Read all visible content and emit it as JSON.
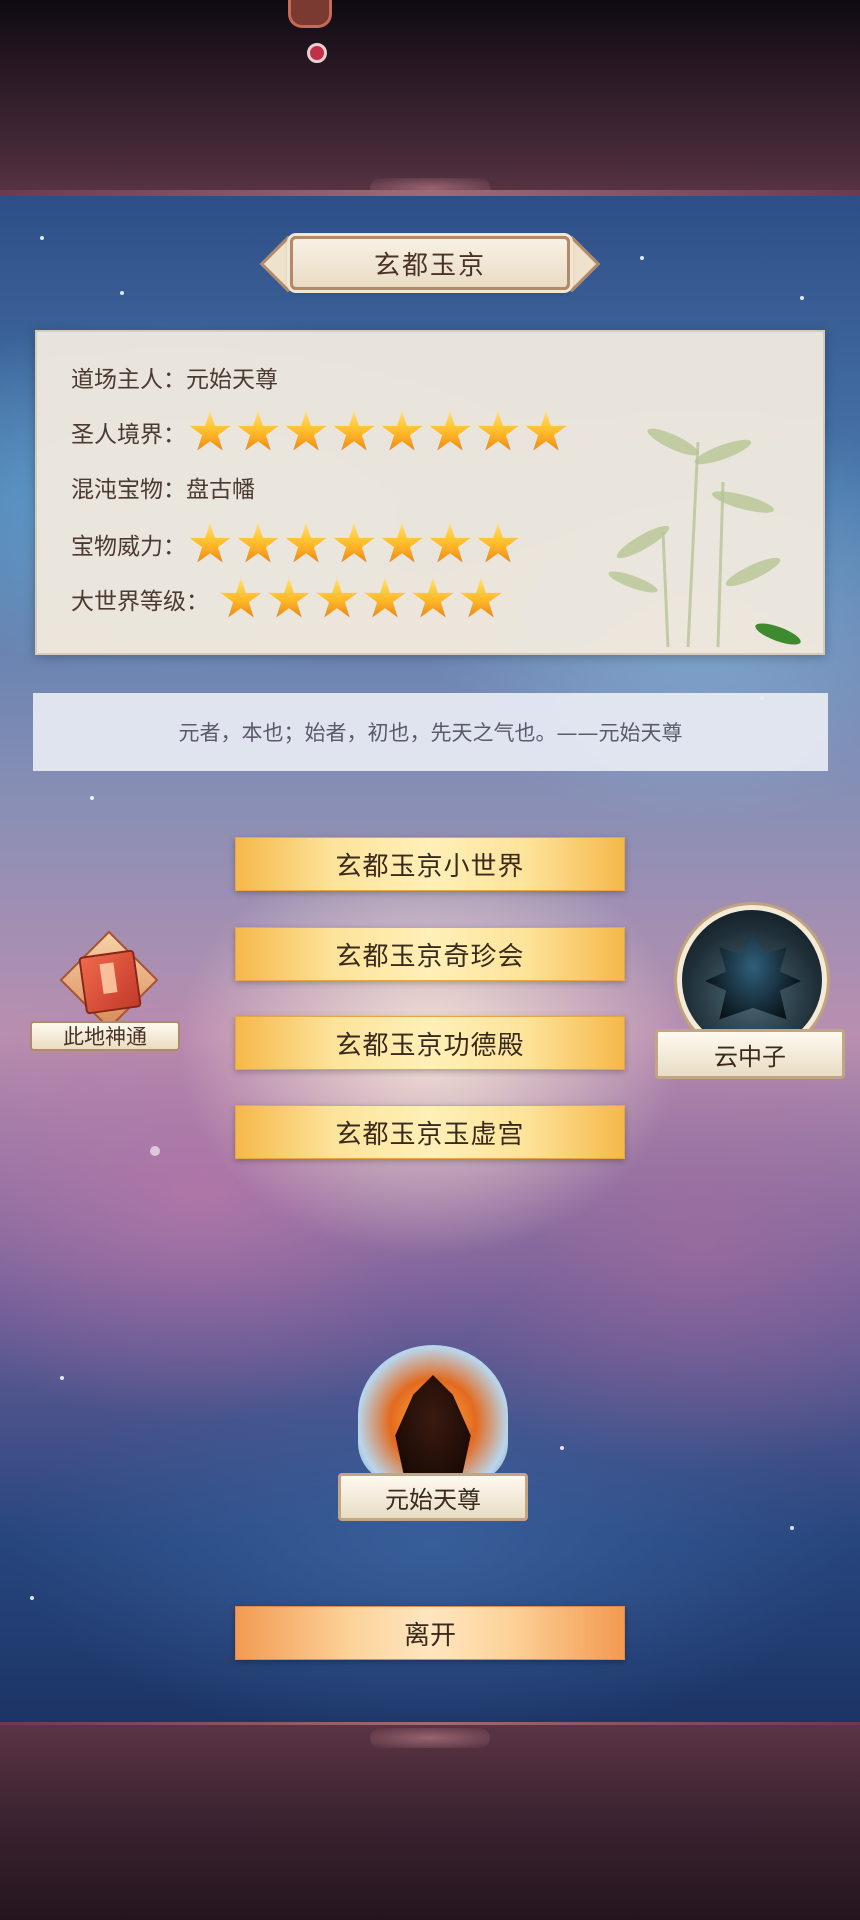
{
  "title": "玄都玉京",
  "info": {
    "owner_label": "道场主人：",
    "owner_value": "元始天尊",
    "realm_label": "圣人境界：",
    "realm_stars": 8,
    "treasure_label": "混沌宝物：",
    "treasure_value": "盘古幡",
    "power_label": "宝物威力：",
    "power_stars": 7,
    "world_label": "大世界等级：",
    "world_stars": 6
  },
  "quote": "元者，本也；始者，初也，先天之气也。——元始天尊",
  "menu": [
    {
      "label": "玄都玉京小世界"
    },
    {
      "label": "玄都玉京奇珍会"
    },
    {
      "label": "玄都玉京功德殿"
    },
    {
      "label": "玄都玉京玉虚宫"
    }
  ],
  "side_badge": {
    "label": "此地神通"
  },
  "npcs": {
    "yunzhongzi": {
      "name": "云中子"
    },
    "yuanshi": {
      "name": "元始天尊"
    }
  },
  "leave_label": "离开",
  "colors": {
    "star": "#ffb526",
    "button_gold": "#fde39a",
    "button_orange": "#f39a52"
  }
}
